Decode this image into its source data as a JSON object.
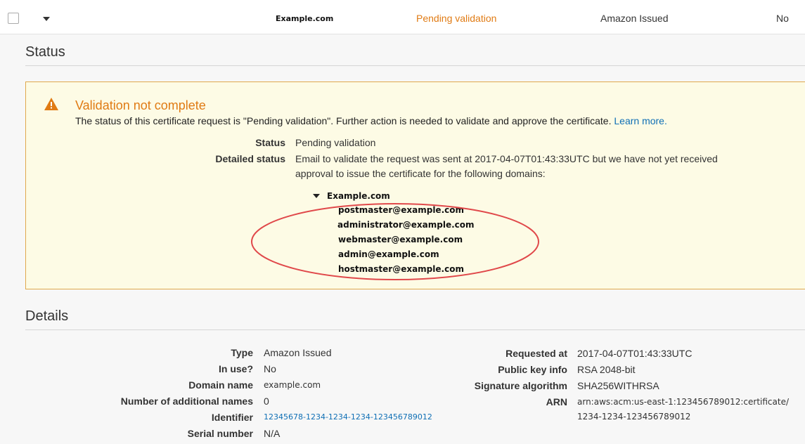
{
  "row": {
    "domain": "Example.com",
    "status": "Pending validation",
    "type": "Amazon Issued",
    "in_use": "No"
  },
  "status_section": {
    "title": "Status",
    "alert": {
      "title": "Validation not complete",
      "message": "The status of this certificate request is \"Pending validation\". Further action is needed to validate and approve the certificate.",
      "link_label": "Learn more.",
      "status_label": "Status",
      "status_value": "Pending validation",
      "detailed_label": "Detailed status",
      "detailed_line1": "Email to validate the request was sent at 2017-04-07T01:43:33UTC but we have not yet received",
      "detailed_line2": "approval to issue the certificate for the following domains:",
      "domain": "Example.com",
      "emails": [
        "postmaster@example.com",
        "administrator@example.com",
        "webmaster@example.com",
        "admin@example.com",
        "hostmaster@example.com"
      ],
      "accent_color": "#e07b14",
      "highlight_color": "#e0484a"
    }
  },
  "details": {
    "title": "Details",
    "left": [
      {
        "label": "Type",
        "value": "Amazon Issued"
      },
      {
        "label": "In use?",
        "value": "No"
      },
      {
        "label": "Domain name",
        "value": "example.com"
      },
      {
        "label": "Number of additional names",
        "value": "0"
      },
      {
        "label": "Identifier",
        "value": "12345678-1234-1234-1234-123456789012"
      },
      {
        "label": "Serial number",
        "value": "N/A"
      }
    ],
    "right": [
      {
        "label": "Requested at",
        "value": "2017-04-07T01:43:33UTC"
      },
      {
        "label": "Public key info",
        "value": "RSA 2048-bit"
      },
      {
        "label": "Signature algorithm",
        "value": "SHA256WITHRSA"
      },
      {
        "label": "ARN",
        "value": "arn:aws:acm:us-east-1:123456789012:certificate/",
        "value2": "1234-1234-123456789012"
      }
    ]
  }
}
